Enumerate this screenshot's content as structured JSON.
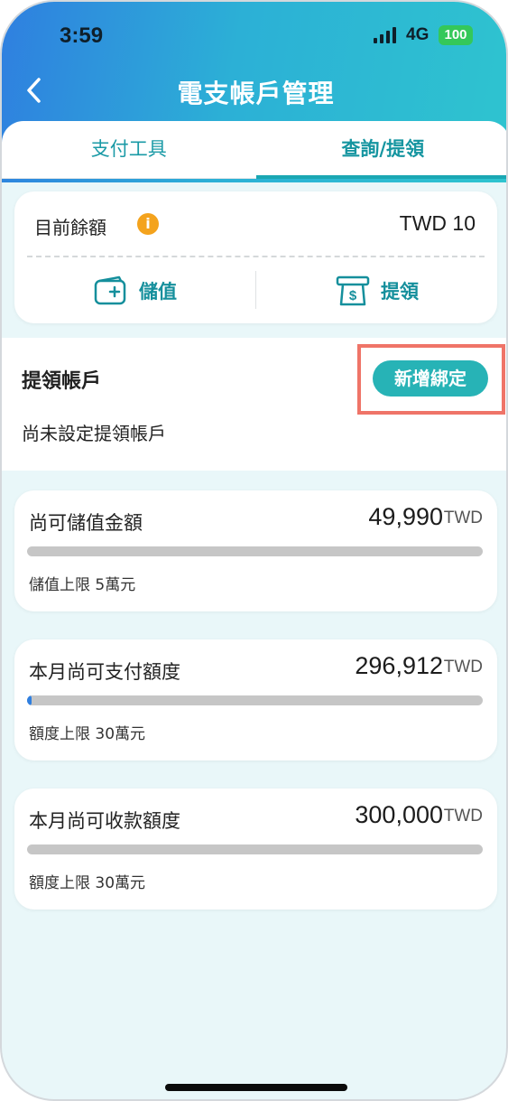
{
  "status_bar": {
    "time": "3:59",
    "network": "4G",
    "battery": "100"
  },
  "nav": {
    "title": "電支帳戶管理"
  },
  "tabs": [
    {
      "label": "支付工具",
      "active": false
    },
    {
      "label": "查詢/提領",
      "active": true
    }
  ],
  "balance": {
    "label": "目前餘額",
    "value": "TWD 10",
    "deposit_label": "儲值",
    "withdraw_label": "提領"
  },
  "withdraw_account": {
    "title": "提領帳戶",
    "status": "尚未設定提領帳戶",
    "bind_button": "新增綁定"
  },
  "limits": [
    {
      "title": "尚可儲值金額",
      "amount": "49,990",
      "currency": "TWD",
      "fill_fraction": 0.0,
      "note": "儲值上限 5萬元"
    },
    {
      "title": "本月尚可支付額度",
      "amount": "296,912",
      "currency": "TWD",
      "fill_fraction": 0.01,
      "note": "額度上限 30萬元"
    },
    {
      "title": "本月尚可收款額度",
      "amount": "300,000",
      "currency": "TWD",
      "fill_fraction": 0.0,
      "note": "額度上限 30萬元"
    }
  ],
  "colors": {
    "accent": "#1aa7b3",
    "button": "#27b3b6",
    "highlight": "#ef7468",
    "info": "#f4a31d",
    "progress": "#2f7fe0"
  }
}
